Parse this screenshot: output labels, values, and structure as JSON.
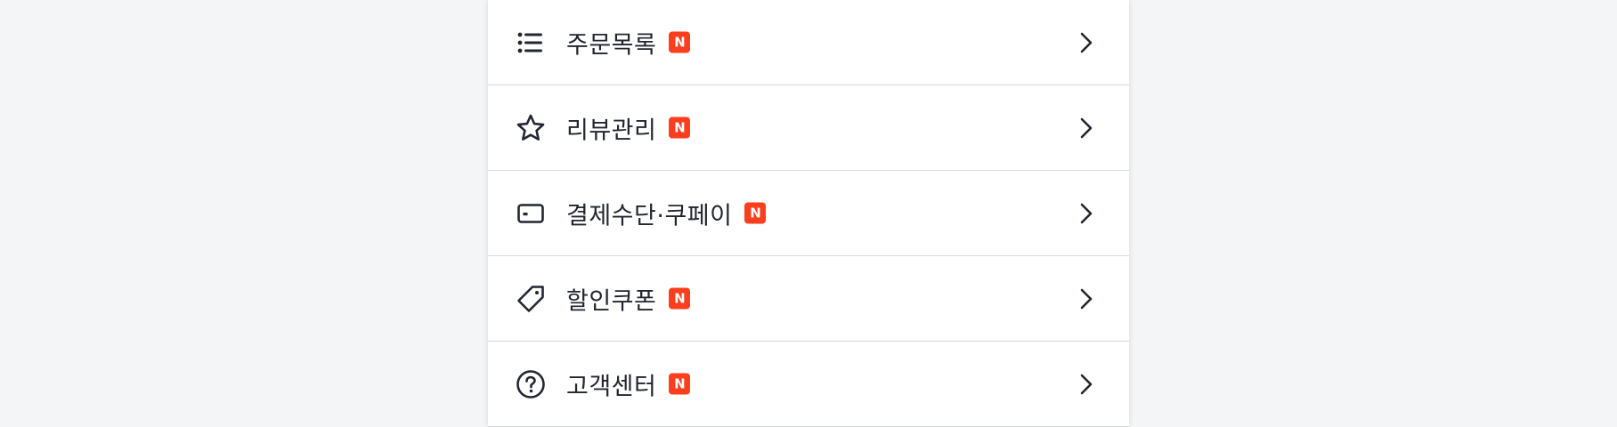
{
  "colors": {
    "background": "#f4f5f7",
    "panel": "#ffffff",
    "text": "#222631",
    "badge": "#fa3e1e",
    "divider": "#d8d9dc"
  },
  "menu": {
    "items": [
      {
        "label": "주문목록",
        "badge": "N",
        "icon": "list-icon"
      },
      {
        "label": "리뷰관리",
        "badge": "N",
        "icon": "star-icon"
      },
      {
        "label": "결제수단·쿠페이",
        "badge": "N",
        "icon": "card-icon"
      },
      {
        "label": "할인쿠폰",
        "badge": "N",
        "icon": "tag-icon"
      },
      {
        "label": "고객센터",
        "badge": "N",
        "icon": "help-circle-icon"
      }
    ]
  }
}
